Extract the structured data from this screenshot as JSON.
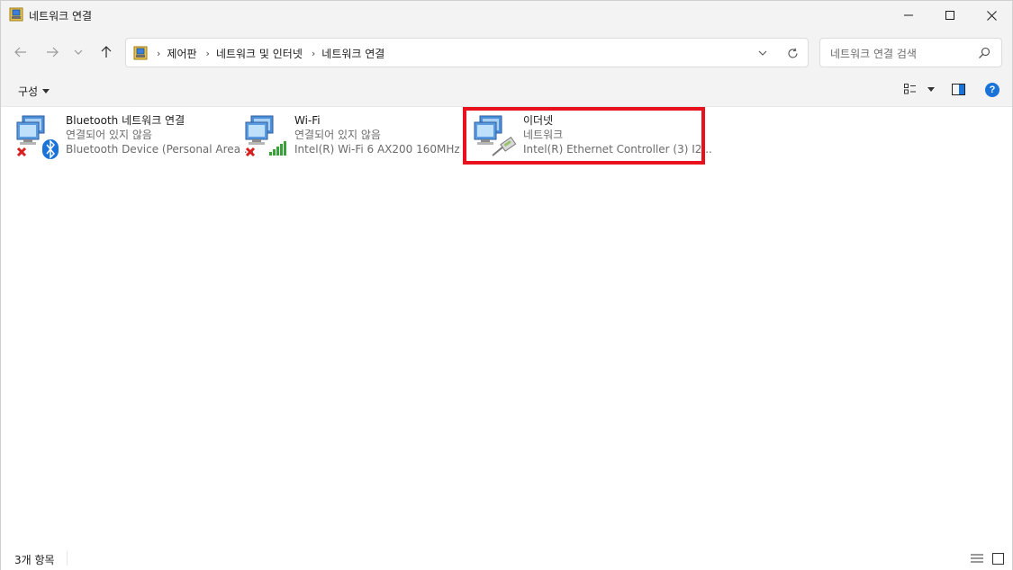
{
  "window": {
    "title": "네트워크 연결",
    "buttons": {
      "minimize": "—",
      "maximize": "☐",
      "close": "✕"
    }
  },
  "nav": {
    "back_icon": "arrow-left-icon",
    "forward_icon": "arrow-right-icon",
    "recent_icon": "chevron-down-icon",
    "up_icon": "arrow-up-icon"
  },
  "address": {
    "crumbs": [
      "제어판",
      "네트워크 및 인터넷",
      "네트워크 연결"
    ],
    "separator": "›"
  },
  "search": {
    "placeholder": "네트워크 연결 검색"
  },
  "cmdbar": {
    "organize_label": "구성"
  },
  "items": [
    {
      "name": "Bluetooth 네트워크 연결",
      "status": "연결되어 있지 않음",
      "device": "Bluetooth Device (Personal Area ...",
      "state": "disconnected",
      "type": "bluetooth"
    },
    {
      "name": "Wi-Fi",
      "status": "연결되어 있지 않음",
      "device": "Intel(R) Wi-Fi 6 AX200 160MHz",
      "state": "disconnected",
      "type": "wifi"
    },
    {
      "name": "이더넷",
      "status": "네트워크",
      "device": "Intel(R) Ethernet Controller (3) I2...",
      "state": "connected",
      "type": "ethernet"
    }
  ],
  "statusbar": {
    "count": "3개 항목"
  },
  "colors": {
    "highlight": "#e8121e",
    "help": "#1a73d9",
    "bluetooth": "#1a73d9",
    "disconnected": "#d81e1e",
    "signal": "#3aa13a"
  }
}
